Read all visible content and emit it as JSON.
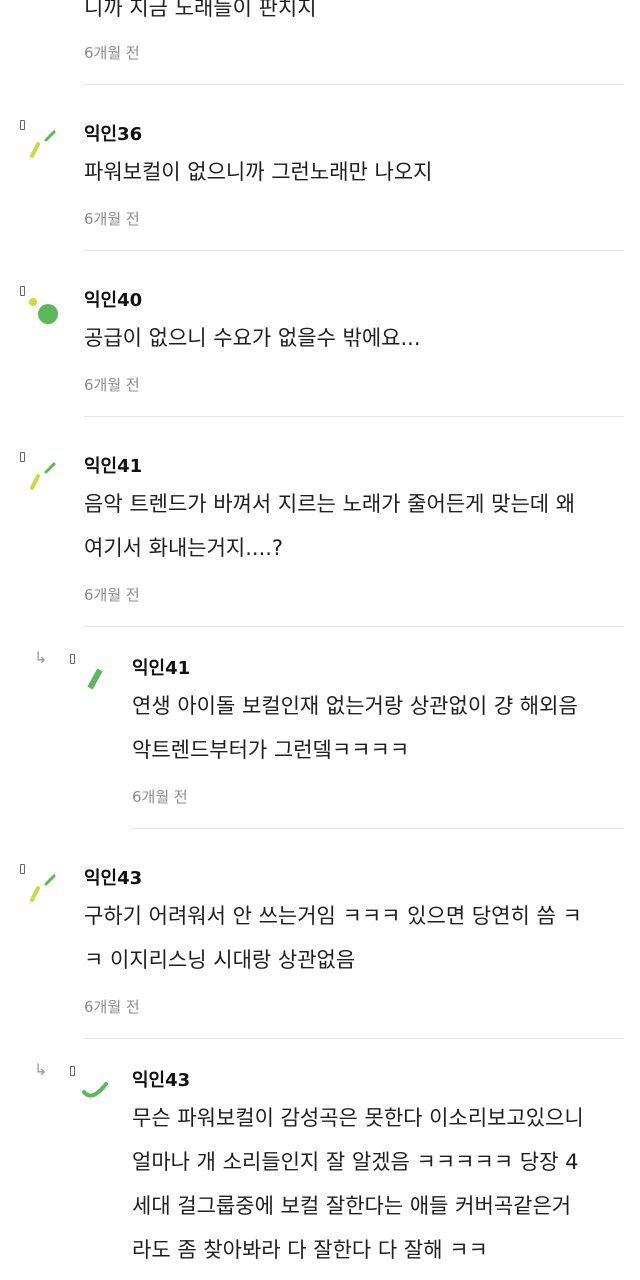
{
  "comments": [
    {
      "tail_text": "니까 지금 노래들이 판치지",
      "time": "6개월 전"
    },
    {
      "nickname": "익인36",
      "lines": [
        "파워보컬이 없으니까 그런노래만 나오지"
      ],
      "time": "6개월 전",
      "avatar": "green-slash-dots"
    },
    {
      "nickname": "익인40",
      "lines": [
        "공급이 없으니 수요가 없을수 밖에요..."
      ],
      "time": "6개월 전",
      "avatar": "green-circle"
    },
    {
      "nickname": "익인41",
      "lines": [
        "음악 트렌드가 바껴서 지르는 노래가 줄어든게 맞는데 왜",
        "여기서 화내는거지....?"
      ],
      "time": "6개월 전",
      "avatar": "green-slash-dots"
    },
    {
      "nickname": "익인41",
      "lines": [
        "연생 아이돌 보컬인재 없는거랑 상관없이 걍 해외음",
        "악트렌드부터가 그런뎈ㅋㅋㅋㅋ"
      ],
      "time": "6개월 전",
      "avatar": "green-bar",
      "reply": true
    },
    {
      "nickname": "익인43",
      "lines": [
        "구하기 어려워서 안 쓰는거임 ㅋㅋㅋ 있으면 당연히 씀 ㅋ",
        "ㅋ 이지리스닝 시대랑 상관없음"
      ],
      "time": "6개월 전",
      "avatar": "green-slash-dots"
    },
    {
      "nickname": "익인43",
      "lines": [
        "무슨 파워보컬이 감성곡은 못한다 이소리보고있으니",
        "얼마나 개 소리들인지 잘 알겠음 ㅋㅋㅋㅋㅋ 당장 4",
        "세대 걸그룹중에 보컬 잘한다는 애들 커버곡같은거",
        "라도 좀 찾아봐라 다 잘한다 다 잘해 ㅋㅋ"
      ],
      "avatar": "green-arc",
      "reply": true
    }
  ],
  "colors": {
    "accent_green": "#5cb85c",
    "accent_yellow": "#c9dc3c",
    "divider": "#e6e6e6"
  }
}
